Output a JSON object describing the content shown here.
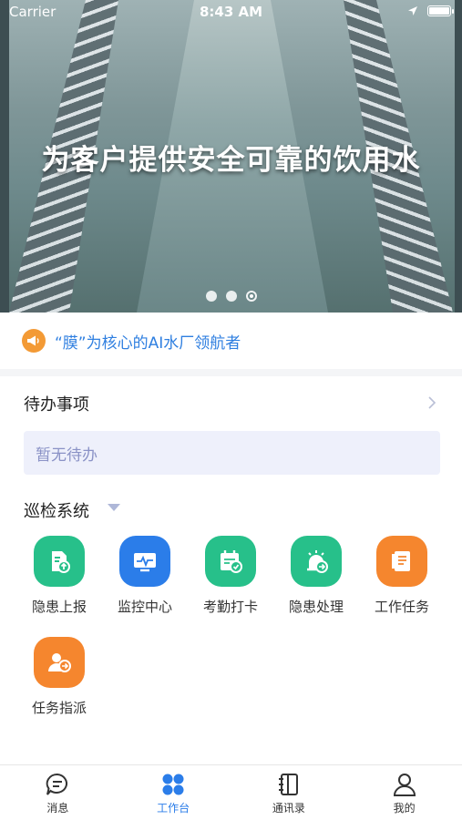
{
  "status_bar": {
    "carrier": "Carrier",
    "time": "8:43 AM"
  },
  "banner": {
    "slogan": "为客户提供安全可靠的饮用水",
    "page_count": 3,
    "active_index": 2
  },
  "notice": {
    "text": "“膜”为核心的AI水厂领航者"
  },
  "todo": {
    "title": "待办事项",
    "empty_text": "暂无待办"
  },
  "patrol": {
    "title": "巡检系统",
    "items": [
      {
        "label": "隐患上报",
        "icon": "hazard-report-icon",
        "color": "#27c08a"
      },
      {
        "label": "监控中心",
        "icon": "monitor-center-icon",
        "color": "#2b7de9"
      },
      {
        "label": "考勤打卡",
        "icon": "attendance-icon",
        "color": "#27c08a"
      },
      {
        "label": "隐患处理",
        "icon": "hazard-handle-icon",
        "color": "#27c08a"
      },
      {
        "label": "工作任务",
        "icon": "work-task-icon",
        "color": "#f5862e"
      },
      {
        "label": "任务指派",
        "icon": "task-assign-icon",
        "color": "#f5862e"
      }
    ]
  },
  "tabbar": {
    "items": [
      {
        "label": "消息",
        "icon": "message-icon",
        "active": false
      },
      {
        "label": "工作台",
        "icon": "workbench-icon",
        "active": true
      },
      {
        "label": "通讯录",
        "icon": "contacts-icon",
        "active": false
      },
      {
        "label": "我的",
        "icon": "profile-icon",
        "active": false
      }
    ],
    "active_color": "#2b7de9"
  }
}
